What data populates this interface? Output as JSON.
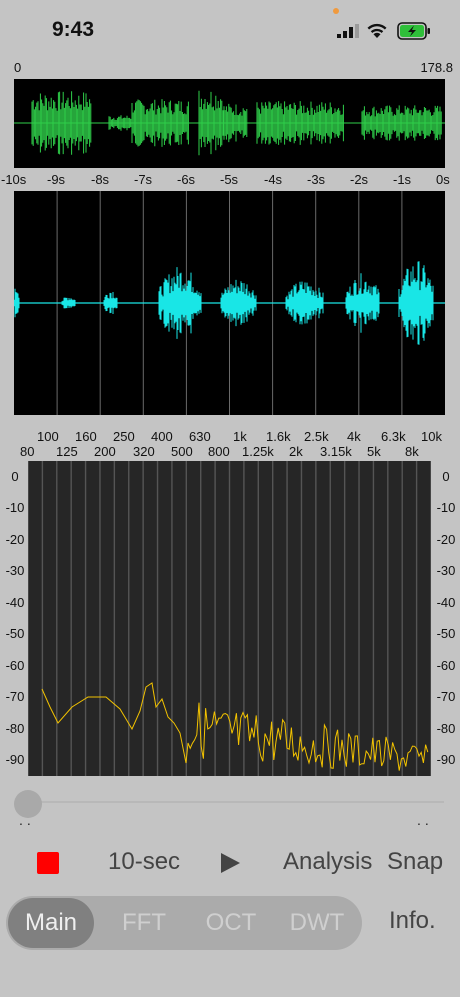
{
  "status": {
    "time": "9:43"
  },
  "overview": {
    "left_label": "0",
    "right_label": "178.8"
  },
  "time_axis": [
    "-10s",
    "-9s",
    "-8s",
    "-7s",
    "-6s",
    "-5s",
    "-4s",
    "-3s",
    "-2s",
    "-1s",
    "0s"
  ],
  "freq_top": [
    "100",
    "160",
    "250",
    "400",
    "630",
    "1k",
    "1.6k",
    "2.5k",
    "4k",
    "6.3k",
    "10k"
  ],
  "freq_bottom": [
    "80",
    "125",
    "200",
    "320",
    "500",
    "800",
    "1.25k",
    "2k",
    "3.15k",
    "5k",
    "8k"
  ],
  "db_labels": [
    "0",
    "-10",
    "-20",
    "-30",
    "-40",
    "-50",
    "-60",
    "-70",
    "-80",
    "-90"
  ],
  "controls": {
    "record_icon": "stop-square-icon",
    "duration": "10-sec",
    "play_icon": "play-icon",
    "analysis": "Analysis",
    "snap": "Snap"
  },
  "tabs": [
    {
      "label": "Main",
      "selected": true
    },
    {
      "label": "FFT"
    },
    {
      "label": "OCT"
    },
    {
      "label": "DWT"
    }
  ],
  "info": "Info.",
  "colors": {
    "overview_wave": "#2fcf4a",
    "scope_wave": "#19e6e6",
    "spectrum_line": "#f2c200",
    "record": "#ff0000"
  }
}
